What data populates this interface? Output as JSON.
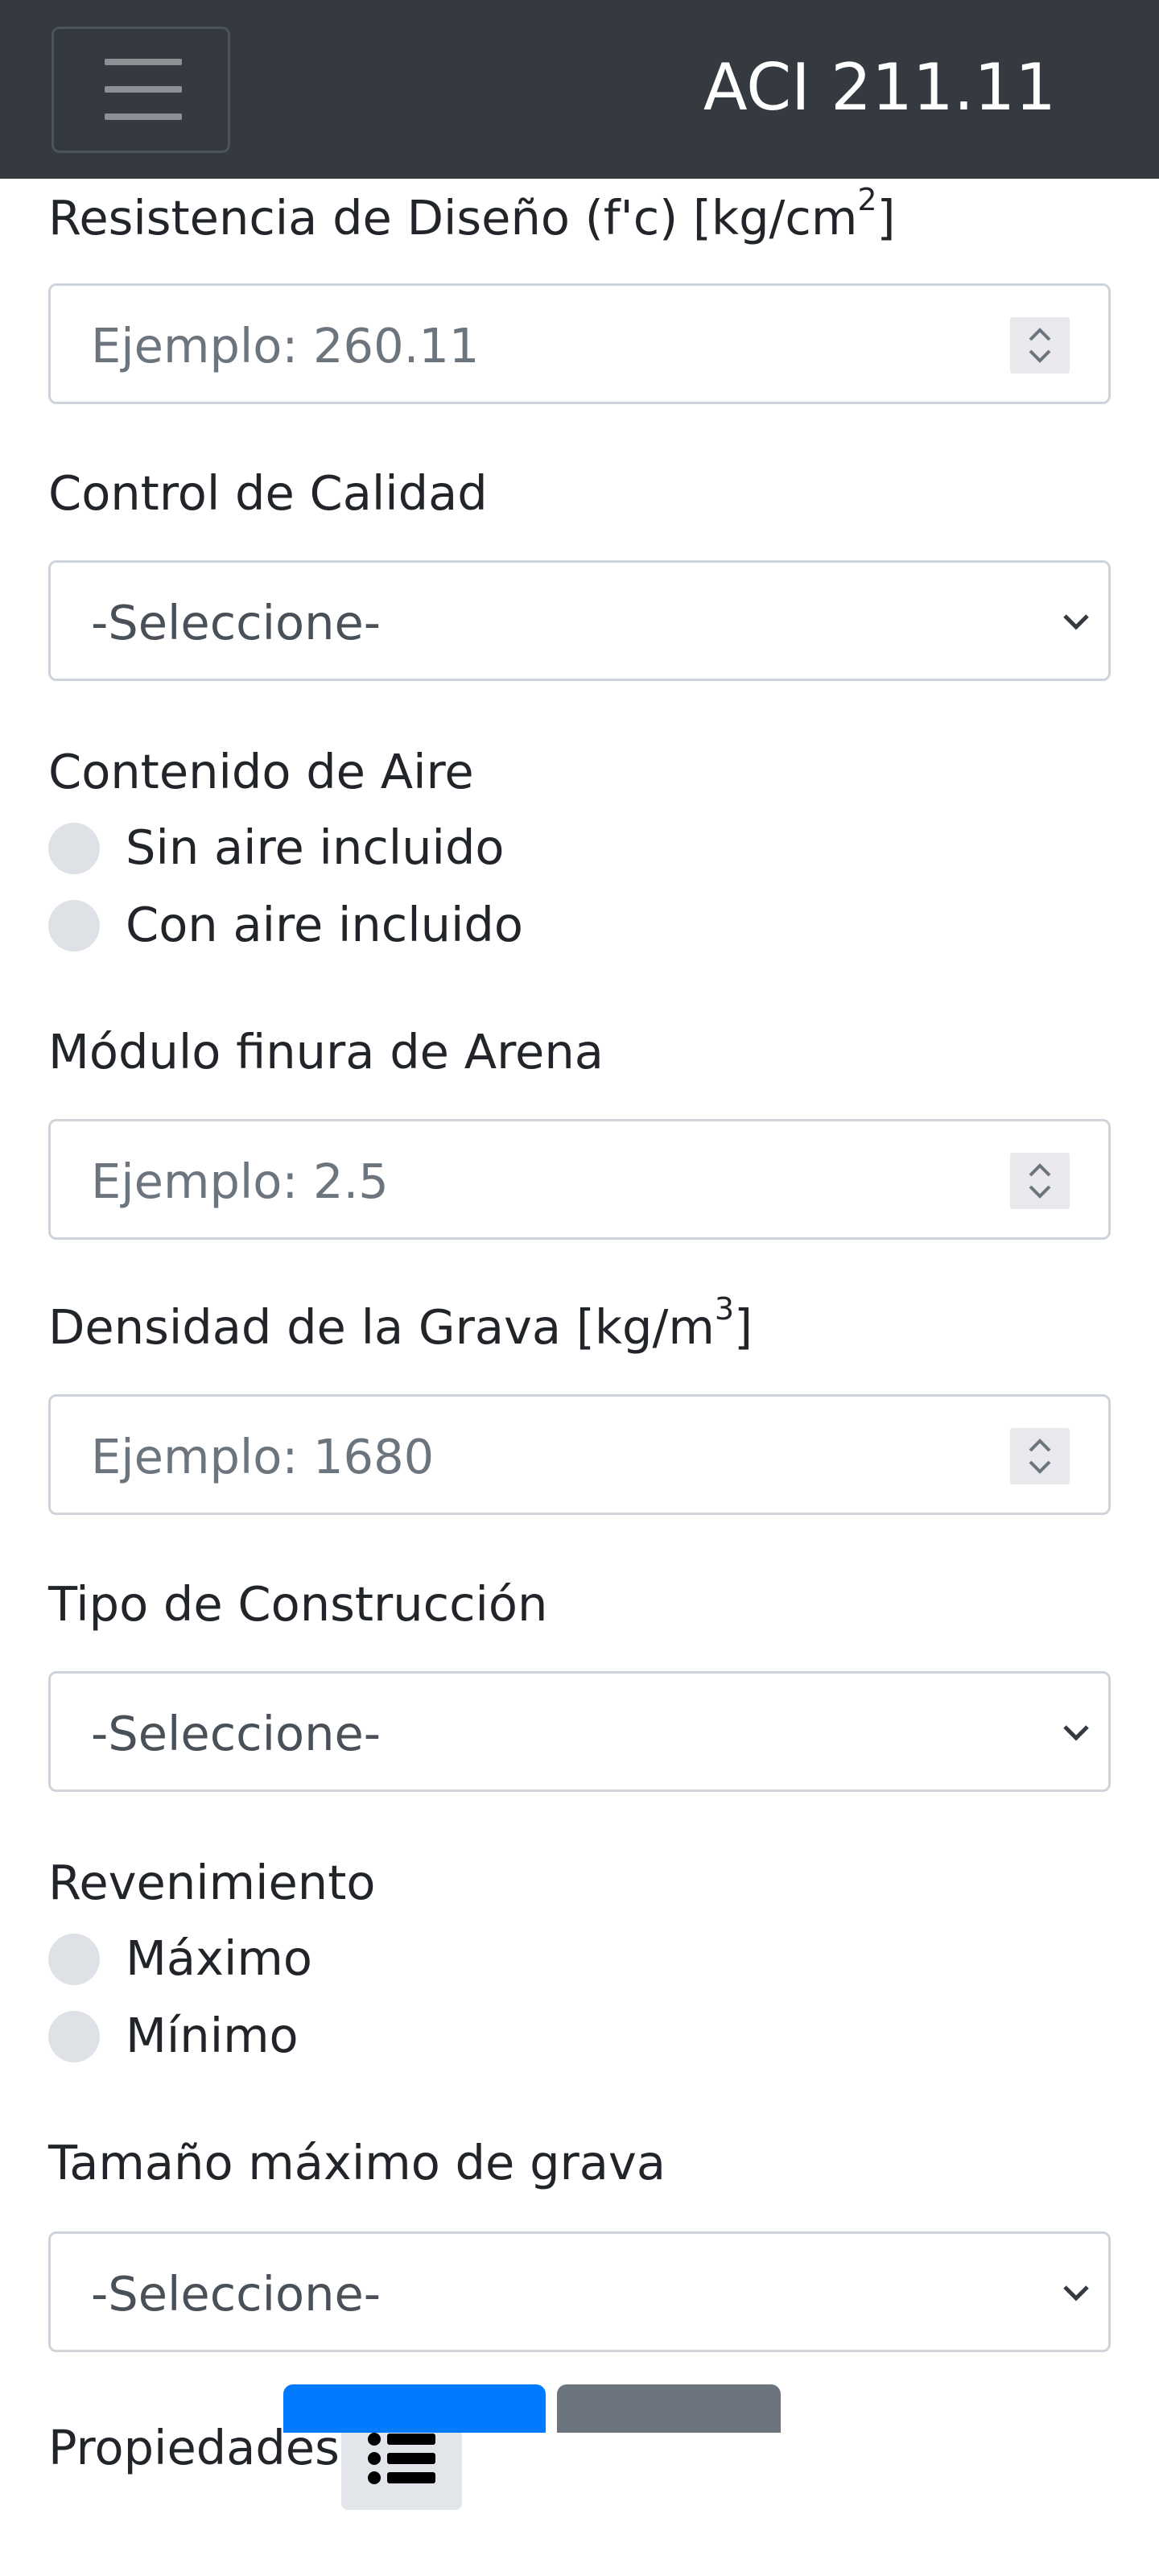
{
  "navbar": {
    "brand": "ACI 211.11",
    "toggler_icon": "hamburger-menu-icon"
  },
  "form": {
    "fc": {
      "label_text": "Resistencia de Diseño (f'c) [kg/cm",
      "label_sup": "2",
      "label_close": "]",
      "placeholder": "Ejemplo: 260.11"
    },
    "quality": {
      "label": "Control de Calidad",
      "selected": "-Seleccione-"
    },
    "air": {
      "label": "Contenido de Aire",
      "options": [
        "Sin aire incluido",
        "Con aire incluido"
      ]
    },
    "fineness": {
      "label": "Módulo finura de Arena",
      "placeholder": "Ejemplo: 2.5"
    },
    "gravel_density": {
      "label_text": "Densidad de la Grava [kg/m",
      "label_sup": "3",
      "label_close": "]",
      "placeholder": "Ejemplo: 1680"
    },
    "construction": {
      "label": "Tipo de Construcción",
      "selected": "-Seleccione-"
    },
    "slump": {
      "label": "Revenimiento",
      "options": [
        "Máximo",
        "Mínimo"
      ]
    },
    "max_gravel": {
      "label": "Tamaño máximo de grava",
      "selected": "-Seleccione-"
    },
    "properties": {
      "label": "Propiedades",
      "button_icon": "list-icon"
    }
  }
}
